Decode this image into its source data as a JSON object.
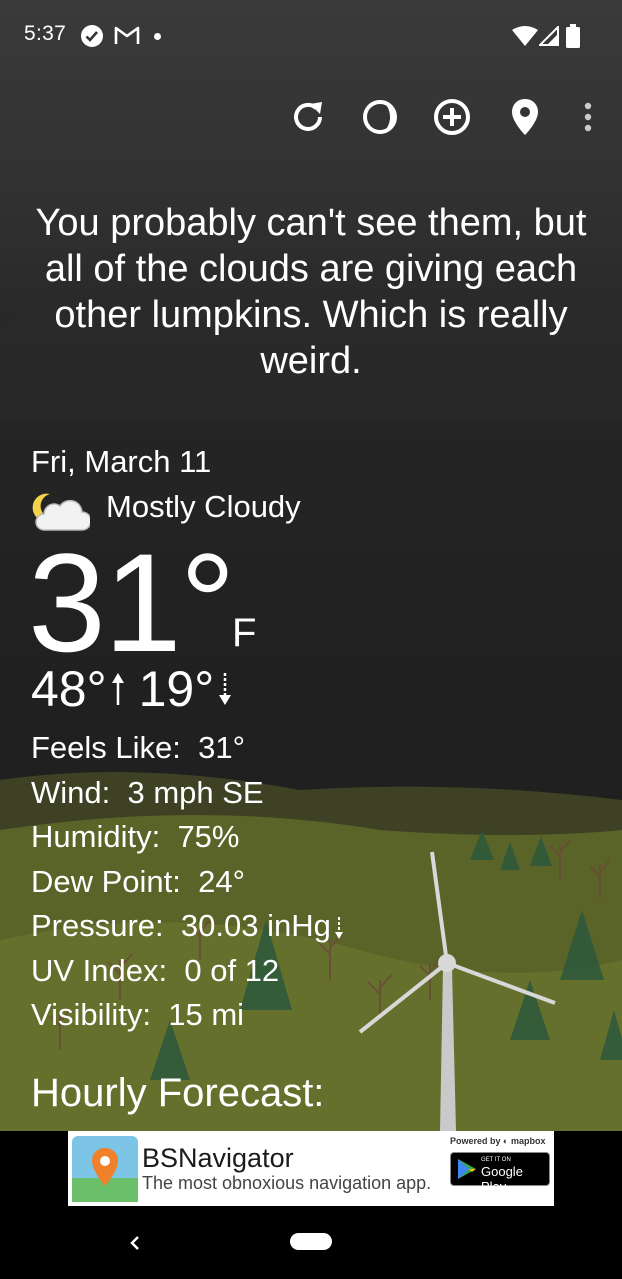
{
  "status_bar": {
    "time": "5:37",
    "icons": [
      "check-circle-icon",
      "gmail-icon",
      "dot-icon",
      "wifi-icon",
      "signal-icon",
      "battery-icon"
    ]
  },
  "toolbar": {
    "icons": [
      "refresh-icon",
      "theme-icon",
      "add-icon",
      "location-pin-icon",
      "more-vert-icon"
    ]
  },
  "quote": "You probably can't see them, but all of the clouds are giving each other lumpkins. Which is really weird.",
  "weather": {
    "date": "Fri, March 11",
    "condition_icon": "partly-cloudy-night-icon",
    "condition": "Mostly Cloudy",
    "temperature": "31°",
    "unit": "F",
    "high": "48°",
    "low": "19°",
    "details": [
      {
        "label": "Feels Like:",
        "value": "31°"
      },
      {
        "label": "Wind:",
        "value": "3 mph SE"
      },
      {
        "label": "Humidity:",
        "value": "75%"
      },
      {
        "label": "Dew Point:",
        "value": "24°"
      },
      {
        "label": "Pressure:",
        "value": "30.03 inHg"
      },
      {
        "label": "UV Index:",
        "value": "0 of 12"
      },
      {
        "label": "Visibility:",
        "value": "15 mi"
      }
    ],
    "hourly_heading": "Hourly Forecast:"
  },
  "ad": {
    "app_name": "BSNavigator",
    "tagline": "The most obnoxious navigation app.",
    "powered_by": "Powered by",
    "powered_brand": "mapbox",
    "store_small": "GET IT ON",
    "store_big": "Google Play"
  },
  "colors": {
    "background": "#1e1e1e",
    "text": "#ffffff",
    "hill": "#5e6a2c"
  }
}
